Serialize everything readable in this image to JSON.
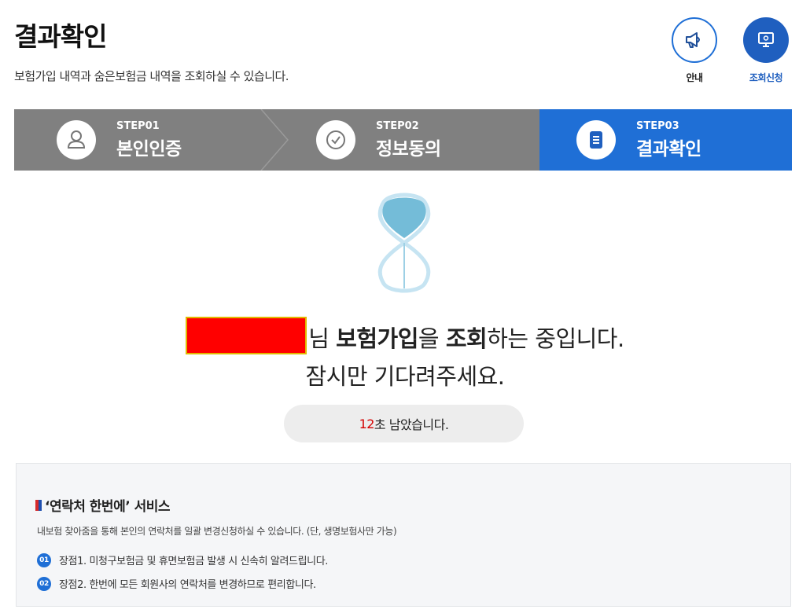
{
  "header": {
    "title": "결과확인",
    "description": "보험가입 내역과 숨은보험금 내역을 조회하실 수 있습니다."
  },
  "top_buttons": {
    "guide": {
      "label": "안내",
      "icon": "megaphone-icon"
    },
    "apply": {
      "label": "조회신청",
      "icon": "monitor-icon"
    }
  },
  "steps": [
    {
      "number": "STEP01",
      "name": "본인인증",
      "icon": "person-icon",
      "active": false
    },
    {
      "number": "STEP02",
      "name": "정보동의",
      "icon": "check-circle-icon",
      "active": false
    },
    {
      "number": "STEP03",
      "name": "결과확인",
      "icon": "document-icon",
      "active": true
    }
  ],
  "status": {
    "line1_suffix": "님",
    "line1_bold1": "보험가입",
    "line1_mid": "을",
    "line1_bold2": "조회",
    "line1_end": "하는 중입니다.",
    "line2": "잠시만 기다려주세요."
  },
  "timer": {
    "seconds": "12",
    "unit_text": "초 남았습니다."
  },
  "service": {
    "title": "‘연락처 한번에’ 서비스",
    "description": "내보험 찾아줌을 통해 본인의 연락처를 일괄 변경신청하실 수 있습니다. (단, 생명보험사만 가능)",
    "items": [
      {
        "num": "01",
        "text": "장점1. 미청구보험금 및 휴면보험금 발생 시 신속히 알려드립니다."
      },
      {
        "num": "02",
        "text": "장점2. 한번에 모든 회원사의 연락처를 변경하므로 편리합니다."
      }
    ]
  },
  "colors": {
    "accent": "#1f6fd6",
    "step_inactive": "#808080",
    "timer_seconds": "#d40000"
  }
}
